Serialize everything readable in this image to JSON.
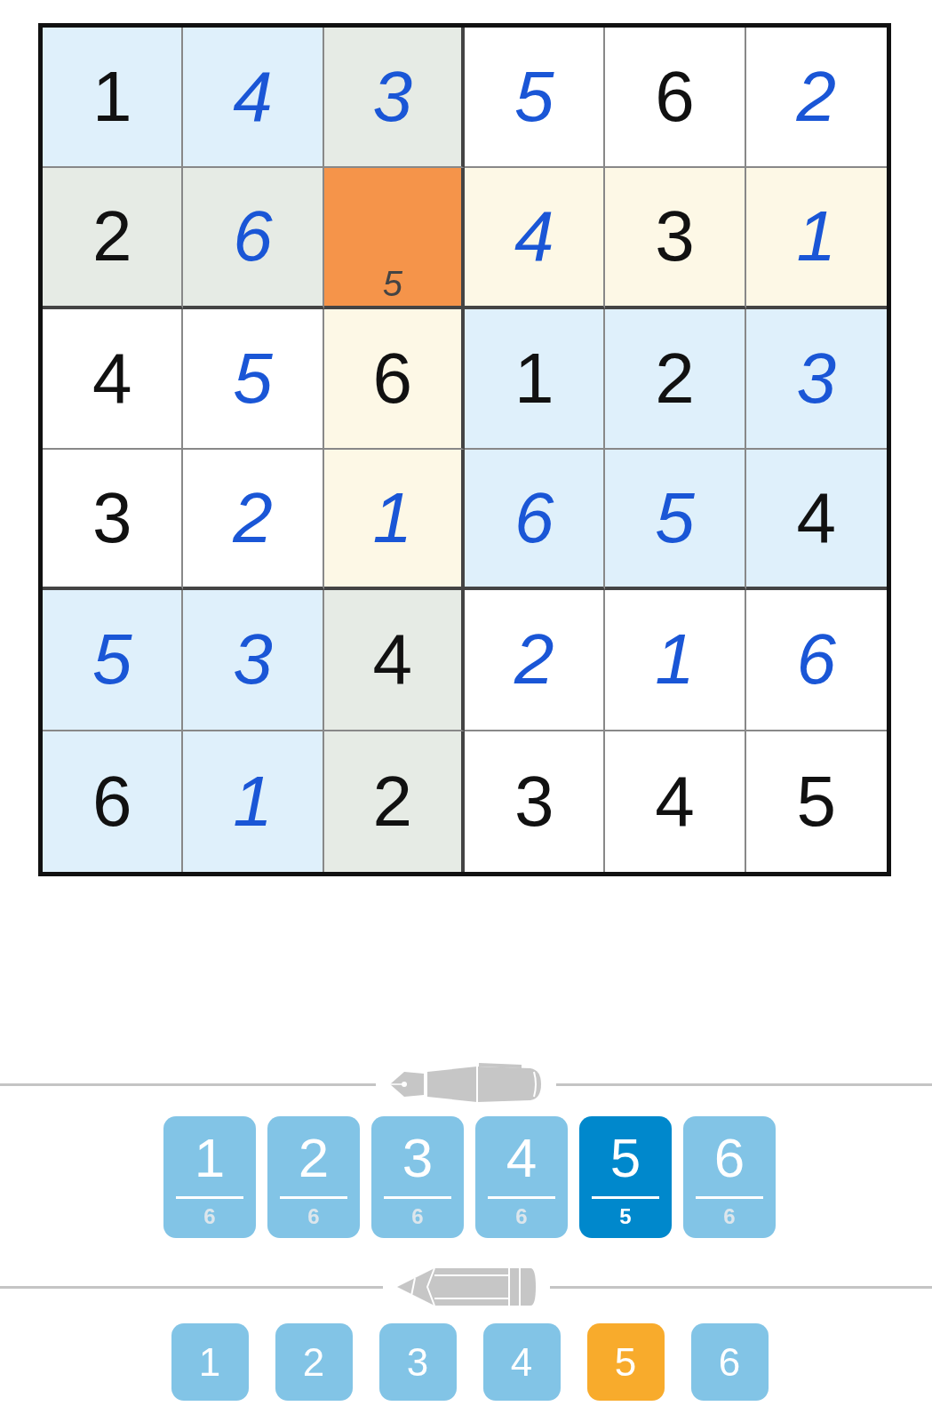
{
  "grid": [
    [
      {
        "kind": "given",
        "value": "1",
        "color": "#dff0fb"
      },
      {
        "kind": "entered",
        "value": "4",
        "color": "#dff0fb"
      },
      {
        "kind": "entered",
        "value": "3",
        "color": "#e6ebe5"
      },
      {
        "kind": "entered",
        "value": "5",
        "color": "#ffffff"
      },
      {
        "kind": "given",
        "value": "6",
        "color": "#ffffff"
      },
      {
        "kind": "entered",
        "value": "2",
        "color": "#ffffff"
      }
    ],
    [
      {
        "kind": "given",
        "value": "2",
        "color": "#e6ebe5"
      },
      {
        "kind": "entered",
        "value": "6",
        "color": "#e6ebe5"
      },
      {
        "kind": "notes",
        "notes": [
          "5"
        ],
        "color": "#f5944a"
      },
      {
        "kind": "entered",
        "value": "4",
        "color": "#fdf8e6"
      },
      {
        "kind": "given",
        "value": "3",
        "color": "#fdf8e6"
      },
      {
        "kind": "entered",
        "value": "1",
        "color": "#fdf8e6"
      }
    ],
    [
      {
        "kind": "given",
        "value": "4",
        "color": "#ffffff"
      },
      {
        "kind": "entered",
        "value": "5",
        "color": "#ffffff"
      },
      {
        "kind": "given",
        "value": "6",
        "color": "#fdf8e6"
      },
      {
        "kind": "given",
        "value": "1",
        "color": "#dff0fb"
      },
      {
        "kind": "given",
        "value": "2",
        "color": "#dff0fb"
      },
      {
        "kind": "entered",
        "value": "3",
        "color": "#dff0fb"
      }
    ],
    [
      {
        "kind": "given",
        "value": "3",
        "color": "#ffffff"
      },
      {
        "kind": "entered",
        "value": "2",
        "color": "#ffffff"
      },
      {
        "kind": "entered",
        "value": "1",
        "color": "#fdf8e6"
      },
      {
        "kind": "entered",
        "value": "6",
        "color": "#dff0fb"
      },
      {
        "kind": "entered",
        "value": "5",
        "color": "#dff0fb"
      },
      {
        "kind": "given",
        "value": "4",
        "color": "#dff0fb"
      }
    ],
    [
      {
        "kind": "entered",
        "value": "5",
        "color": "#dff0fb"
      },
      {
        "kind": "entered",
        "value": "3",
        "color": "#dff0fb"
      },
      {
        "kind": "given",
        "value": "4",
        "color": "#e6ebe5"
      },
      {
        "kind": "entered",
        "value": "2",
        "color": "#ffffff"
      },
      {
        "kind": "entered",
        "value": "1",
        "color": "#ffffff"
      },
      {
        "kind": "entered",
        "value": "6",
        "color": "#ffffff"
      }
    ],
    [
      {
        "kind": "given",
        "value": "6",
        "color": "#dff0fb"
      },
      {
        "kind": "entered",
        "value": "1",
        "color": "#dff0fb"
      },
      {
        "kind": "given",
        "value": "2",
        "color": "#e6ebe5"
      },
      {
        "kind": "given",
        "value": "3",
        "color": "#ffffff"
      },
      {
        "kind": "given",
        "value": "4",
        "color": "#ffffff"
      },
      {
        "kind": "given",
        "value": "5",
        "color": "#ffffff"
      }
    ]
  ],
  "pen_keys": [
    {
      "digit": "1",
      "count": "6",
      "selected": false
    },
    {
      "digit": "2",
      "count": "6",
      "selected": false
    },
    {
      "digit": "3",
      "count": "6",
      "selected": false
    },
    {
      "digit": "4",
      "count": "6",
      "selected": false
    },
    {
      "digit": "5",
      "count": "5",
      "selected": true
    },
    {
      "digit": "6",
      "count": "6",
      "selected": false
    }
  ],
  "pencil_keys": [
    {
      "digit": "1",
      "selected": false
    },
    {
      "digit": "2",
      "selected": false
    },
    {
      "digit": "3",
      "selected": false
    },
    {
      "digit": "4",
      "selected": false
    },
    {
      "digit": "5",
      "selected": true
    },
    {
      "digit": "6",
      "selected": false
    }
  ]
}
